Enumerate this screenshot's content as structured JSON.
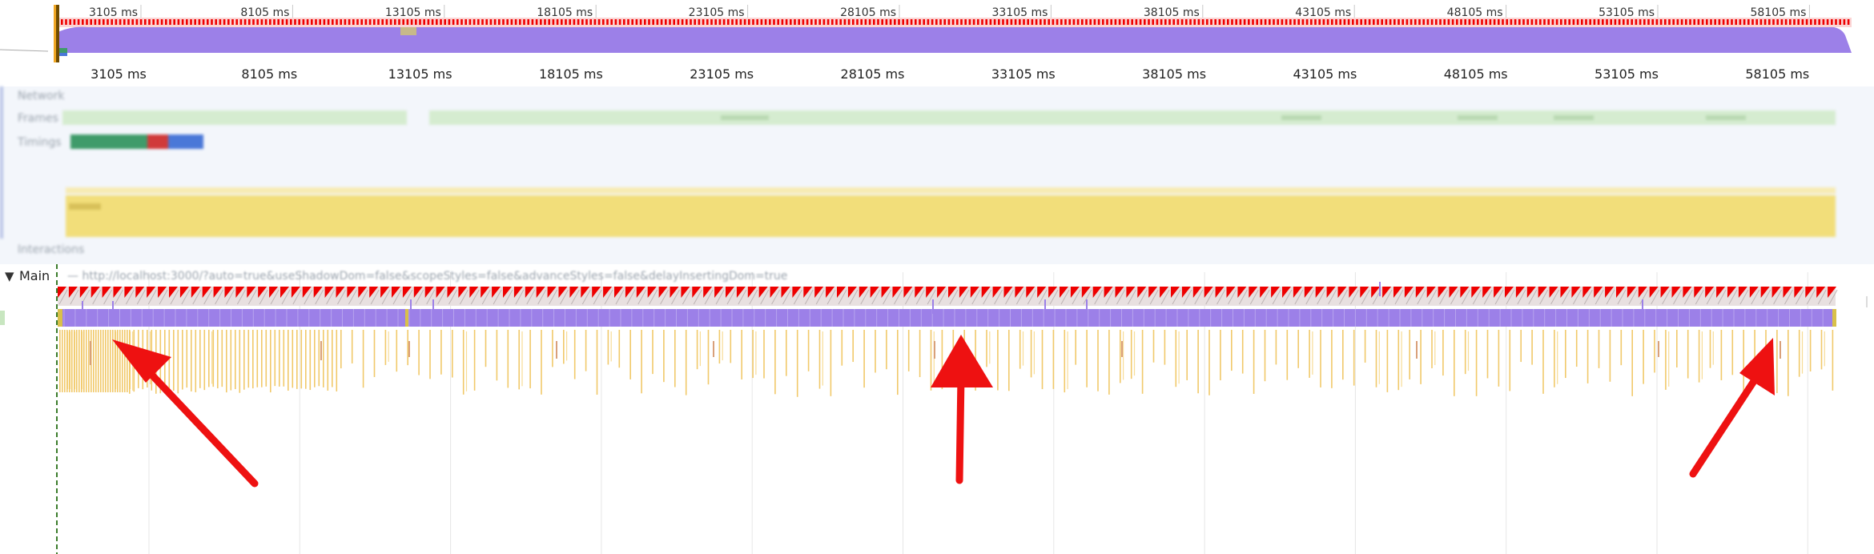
{
  "overview": {
    "tick_labels": [
      "3105 ms",
      "8105 ms",
      "13105 ms",
      "18105 ms",
      "23105 ms",
      "28105 ms",
      "33105 ms",
      "38105 ms",
      "43105 ms",
      "48105 ms",
      "53105 ms",
      "58105 ms"
    ]
  },
  "ruler": {
    "tick_labels": [
      "3105 ms",
      "8105 ms",
      "13105 ms",
      "18105 ms",
      "23105 ms",
      "28105 ms",
      "33105 ms",
      "38105 ms",
      "43105 ms",
      "48105 ms",
      "53105 ms",
      "58105 ms"
    ]
  },
  "tracks": {
    "network_label": "Network",
    "frames_label": "Frames",
    "timings_label": "Timings",
    "interactions_label": "Interactions"
  },
  "main": {
    "toggle_icon": "triangle-down-icon",
    "title": "Main",
    "url": "— http://localhost:3000/?auto=true&useShadowDom=false&scopeStyles=false&advanceStyles=false&delayInsertingDom=true"
  },
  "colors": {
    "task_red": "#ee0000",
    "scripting_purple": "#9c80e8",
    "scripting_yellow": "#f4d35e",
    "frame_green": "#d5ecd0",
    "arrow_red": "#ee1111"
  }
}
